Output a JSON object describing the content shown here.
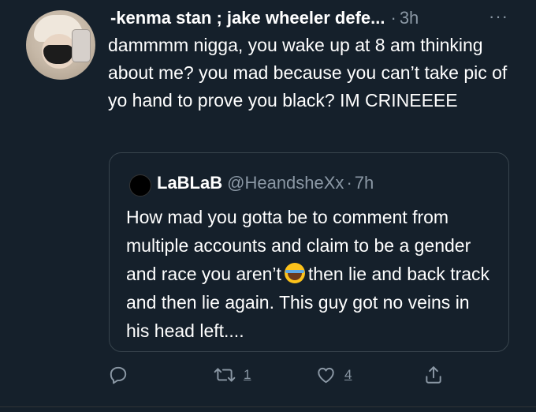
{
  "tweet": {
    "author_name": "-kenma stan ; jake wheeler defe...",
    "separator": "·",
    "time": "3h",
    "more": "···",
    "text": "dammmm nigga, you wake up at 8 am thinking about me? you mad because you can’t take pic of yo hand to prove you black? IM CRINEEEE"
  },
  "quoted_tweet": {
    "author_name": "LaBLaB",
    "handle": "@HeandsheXx",
    "separator": "·",
    "time": "7h",
    "text_before_emoji": "How mad you gotta be to comment from multiple accounts and claim to be a gender and race you aren’t",
    "emoji": "face-with-tears-of-joy",
    "text_after_emoji": "then lie and back track and then lie again. This guy got no veins in his head left...."
  },
  "actions": {
    "retweet_count": "1",
    "like_count": "4"
  },
  "colors": {
    "background": "#15202b",
    "text_primary": "#ffffff",
    "text_secondary": "#8b98a5",
    "border": "#38444d"
  },
  "icons": {
    "reply": "reply-icon",
    "retweet": "retweet-icon",
    "like": "heart-icon",
    "share": "share-icon"
  }
}
